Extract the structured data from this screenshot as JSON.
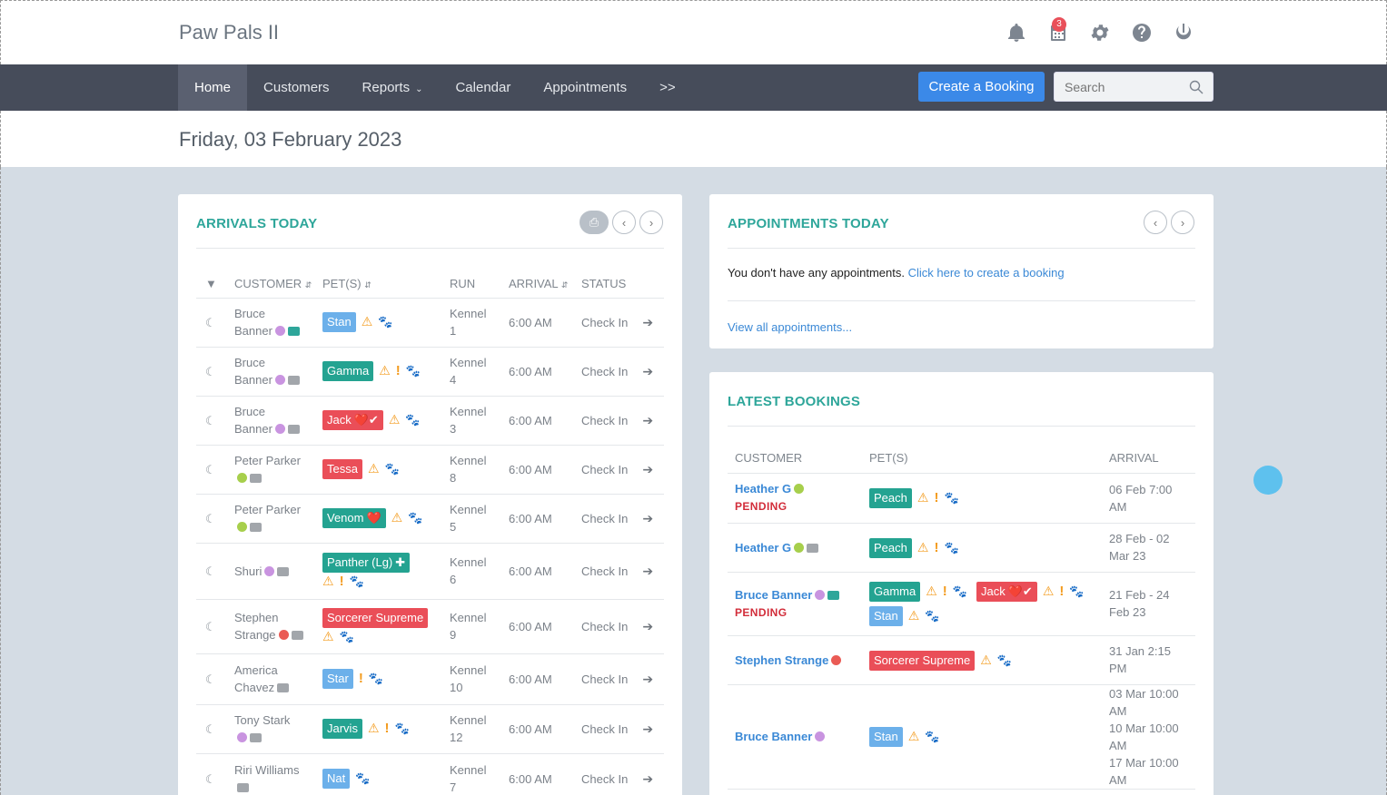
{
  "app": {
    "title": "Paw Pals II",
    "notif_count": "3"
  },
  "nav": {
    "items": [
      "Home",
      "Customers",
      "Reports",
      "Calendar",
      "Appointments",
      ">>"
    ],
    "create_booking": "Create a Booking",
    "search_placeholder": "Search"
  },
  "date": "Friday, 03 February 2023",
  "arrivals": {
    "title": "ARRIVALS TODAY",
    "headers": {
      "customer": "CUSTOMER",
      "pets": "PET(S)",
      "run": "RUN",
      "arrival": "ARRIVAL",
      "status": "STATUS"
    },
    "rows": [
      {
        "customer_1": "Bruce",
        "customer_2": "Banner",
        "dot": "purple",
        "bag": "teal",
        "pets": [
          {
            "name": "Stan",
            "color": "blue",
            "extra": ""
          }
        ],
        "warn": true,
        "excl": false,
        "run_1": "Kennel",
        "run_2": "1",
        "arrival": "6:00 AM",
        "status": "Check In"
      },
      {
        "customer_1": "Bruce",
        "customer_2": "Banner",
        "dot": "purple",
        "bag": "gray",
        "pets": [
          {
            "name": "Gamma",
            "color": "teal",
            "extra": ""
          }
        ],
        "warn": true,
        "excl": true,
        "run_1": "Kennel",
        "run_2": "4",
        "arrival": "6:00 AM",
        "status": "Check In"
      },
      {
        "customer_1": "Bruce",
        "customer_2": "Banner",
        "dot": "purple",
        "bag": "gray",
        "pets": [
          {
            "name": "Jack",
            "color": "red",
            "extra": "❤️✔"
          }
        ],
        "warn": true,
        "excl": false,
        "run_1": "Kennel",
        "run_2": "3",
        "arrival": "6:00 AM",
        "status": "Check In"
      },
      {
        "customer_1": "Peter Parker",
        "customer_2": "",
        "dot": "green",
        "bag": "gray",
        "pets": [
          {
            "name": "Tessa",
            "color": "red",
            "extra": ""
          }
        ],
        "warn": true,
        "excl": false,
        "run_1": "Kennel",
        "run_2": "8",
        "arrival": "6:00 AM",
        "status": "Check In"
      },
      {
        "customer_1": "Peter Parker",
        "customer_2": "",
        "dot": "green",
        "bag": "gray",
        "pets": [
          {
            "name": "Venom",
            "color": "teal",
            "extra": "❤️"
          }
        ],
        "warn": true,
        "excl": false,
        "run_1": "Kennel",
        "run_2": "5",
        "arrival": "6:00 AM",
        "status": "Check In"
      },
      {
        "customer_1": "Shuri",
        "customer_2": "",
        "dot": "purple",
        "bag": "gray",
        "pets": [
          {
            "name": "Panther (Lg)",
            "color": "teal",
            "extra": "✚"
          }
        ],
        "warn": true,
        "excl": true,
        "run_1": "Kennel",
        "run_2": "6",
        "arrival": "6:00 AM",
        "status": "Check In"
      },
      {
        "customer_1": "Stephen",
        "customer_2": "Strange",
        "dot": "red",
        "bag": "gray",
        "pets": [
          {
            "name": "Sorcerer Supreme",
            "color": "red",
            "extra": ""
          }
        ],
        "warn": true,
        "excl": false,
        "run_1": "Kennel",
        "run_2": "9",
        "arrival": "6:00 AM",
        "status": "Check In"
      },
      {
        "customer_1": "America",
        "customer_2": "Chavez",
        "dot": "",
        "bag": "gray",
        "pets": [
          {
            "name": "Star",
            "color": "blue",
            "extra": ""
          }
        ],
        "warn": false,
        "excl": true,
        "run_1": "Kennel",
        "run_2": "10",
        "arrival": "6:00 AM",
        "status": "Check In"
      },
      {
        "customer_1": "Tony Stark",
        "customer_2": "",
        "dot": "purple",
        "bag": "gray",
        "pets": [
          {
            "name": "Jarvis",
            "color": "teal",
            "extra": ""
          }
        ],
        "warn": true,
        "excl": true,
        "run_1": "Kennel",
        "run_2": "12",
        "arrival": "6:00 AM",
        "status": "Check In"
      },
      {
        "customer_1": "Riri Williams",
        "customer_2": "",
        "dot": "",
        "bag": "gray",
        "pets": [
          {
            "name": "Nat",
            "color": "blue",
            "extra": ""
          }
        ],
        "warn": false,
        "excl": false,
        "run_1": "Kennel",
        "run_2": "7",
        "arrival": "6:00 AM",
        "status": "Check In"
      }
    ]
  },
  "appointments": {
    "title": "APPOINTMENTS TODAY",
    "empty_text": "You don't have any appointments.",
    "create_link": "Click here to create a booking",
    "view_all": "View all appointments..."
  },
  "latest": {
    "title": "LATEST BOOKINGS",
    "headers": {
      "customer": "CUSTOMER",
      "pets": "PET(S)",
      "arrival": "ARRIVAL"
    },
    "pending_label": "PENDING",
    "rows": [
      {
        "customer": "Heather G",
        "dot": "green",
        "bag": "",
        "pending": true,
        "arrival": "06 Feb 7:00 AM"
      },
      {
        "customer": "Heather G",
        "dot": "green",
        "bag": "gray",
        "pending": false,
        "arrival": "28 Feb - 02 Mar 23"
      },
      {
        "customer": "Bruce Banner",
        "dot": "purple",
        "bag": "teal",
        "pending": true,
        "arrival": "21 Feb - 24 Feb 23"
      },
      {
        "customer": "Stephen Strange",
        "dot": "red",
        "bag": "",
        "pending": false,
        "arrival": "31 Jan 2:15 PM"
      },
      {
        "customer": "Bruce Banner",
        "dot": "purple",
        "bag": "",
        "pending": false,
        "arrival": "03 Mar 10:00 AM 10 Mar 10:00 AM 17 Mar 10:00 AM"
      }
    ],
    "pets": {
      "r0": [
        "Peach"
      ],
      "r1": [
        "Peach"
      ],
      "r2a": [
        "Gamma",
        "Jack"
      ],
      "r2b": [
        "Stan"
      ],
      "r3": [
        "Sorcerer Supreme"
      ],
      "r4": [
        "Stan"
      ]
    },
    "arrival_lines": {
      "r0": [
        "06 Feb 7:00",
        "AM"
      ],
      "r1": [
        "28 Feb - 02",
        "Mar 23"
      ],
      "r2": [
        "21 Feb - 24",
        "Feb 23"
      ],
      "r3": [
        "31 Jan 2:15",
        "PM"
      ],
      "r4": [
        "03 Mar 10:00",
        "AM",
        "10 Mar 10:00",
        "AM",
        "17 Mar 10:00",
        "AM"
      ]
    },
    "jack_extra": "❤️✔"
  },
  "colors": {
    "accent_teal": "#2ea69a",
    "nav_bg": "#464c5a",
    "primary_blue": "#3b89e8",
    "pending_red": "#d22d3a"
  },
  "icons": [
    "bell-icon",
    "calendar-icon",
    "gear-icon",
    "help-icon",
    "power-icon",
    "search-icon",
    "print-icon",
    "chevron-left-icon",
    "chevron-right-icon",
    "filter-icon",
    "moon-icon",
    "arrow-right-icon",
    "warning-icon",
    "exclamation-icon",
    "paw-icon"
  ]
}
